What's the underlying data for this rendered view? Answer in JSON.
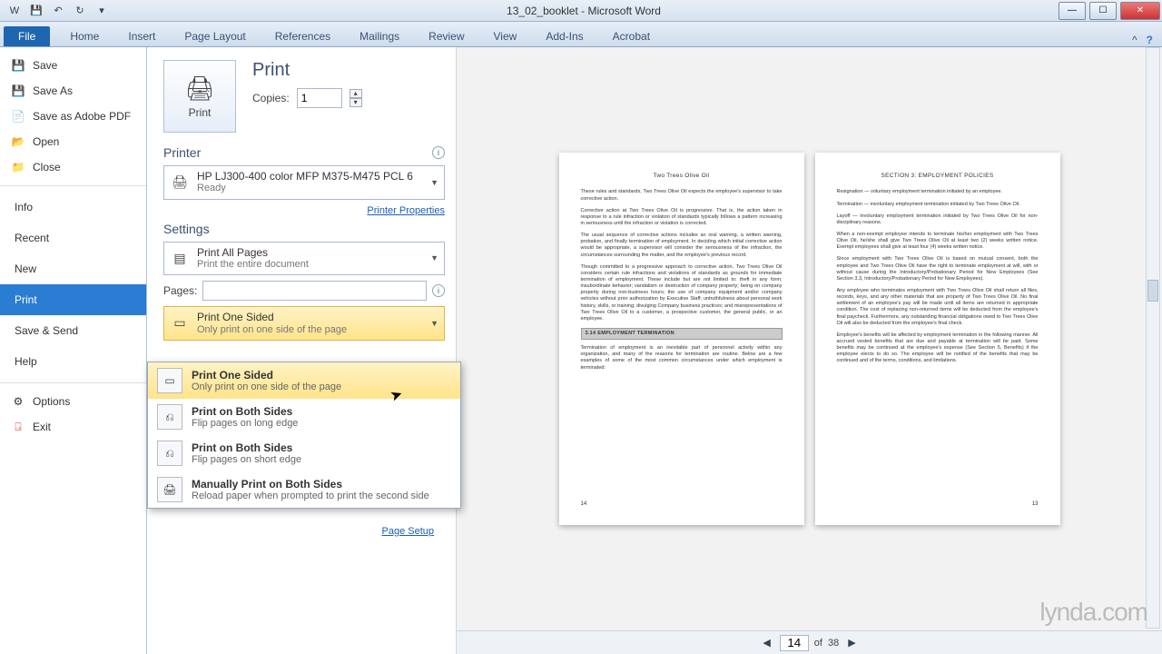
{
  "titlebar": {
    "doc": "13_02_booklet",
    "app": "Microsoft Word"
  },
  "ribbon": {
    "file": "File",
    "tabs": [
      "Home",
      "Insert",
      "Page Layout",
      "References",
      "Mailings",
      "Review",
      "View",
      "Add-Ins",
      "Acrobat"
    ]
  },
  "backstage": {
    "save": "Save",
    "saveas": "Save As",
    "saveadobe": "Save as Adobe PDF",
    "open": "Open",
    "close": "Close",
    "info": "Info",
    "recent": "Recent",
    "new": "New",
    "print": "Print",
    "savesend": "Save & Send",
    "help": "Help",
    "options": "Options",
    "exit": "Exit"
  },
  "print": {
    "heading": "Print",
    "button": "Print",
    "copies_label": "Copies:",
    "copies_value": "1",
    "printer_label": "Printer",
    "printer_name": "HP LJ300-400 color MFP M375-M475 PCL 6",
    "printer_status": "Ready",
    "printer_props": "Printer Properties",
    "settings_label": "Settings",
    "pages_scope_title": "Print All Pages",
    "pages_scope_sub": "Print the entire document",
    "pages_label": "Pages:",
    "duplex_sel_title": "Print One Sided",
    "duplex_sel_sub": "Only print on one side of the page",
    "page_setup": "Page Setup"
  },
  "duplex_options": [
    {
      "t": "Print One Sided",
      "s": "Only print on one side of the page"
    },
    {
      "t": "Print on Both Sides",
      "s": "Flip pages on long edge"
    },
    {
      "t": "Print on Both Sides",
      "s": "Flip pages on short edge"
    },
    {
      "t": "Manually Print on Both Sides",
      "s": "Reload paper when prompted to print the second side"
    }
  ],
  "preview": {
    "page_left_title": "Two Trees Olive Oil",
    "page_left_num": "14",
    "page_left_sect": "3.14 EMPLOYMENT TERMINATION",
    "page_left_paras": [
      "These rules and standards, Two Trees Olive Oil expects the employee's supervisor to take corrective action.",
      "Corrective action at Two Trees Olive Oil is progressive. That is, the action taken in response to a rule infraction or violation of standards typically follows a pattern increasing in seriousness until the infraction or violation is corrected.",
      "The usual sequence of corrective actions includes an oral warning, a written warning, probation, and finally termination of employment. In deciding which initial corrective action would be appropriate, a supervisor will consider the seriousness of the infraction, the circumstances surrounding the matter, and the employee's previous record.",
      "Though committed to a progressive approach to corrective action, Two Trees Olive Oil considers certain rule infractions and violations of standards as grounds for immediate termination of employment. These include but are not limited to: theft in any form; insubordinate behavior; vandalism or destruction of company property; being on company property during non-business hours; the use of company equipment and/or company vehicles without prior authorization by Executive Staff; untruthfulness about personal work history, skills, or training; divulging Company business practices; and misrepresentations of Two Trees Olive Oil to a customer, a prospective customer, the general public, or an employee."
    ],
    "page_left_after": "Termination of employment is an inevitable part of personnel activity within any organization, and many of the reasons for termination are routine. Below are a few examples of some of the most common circumstances under which employment is terminated:",
    "page_right_title": "SECTION 3: EMPLOYMENT POLICIES",
    "page_right_num": "13",
    "page_right_paras": [
      "Resignation — voluntary employment termination initiated by an employee.",
      "Termination — involuntary employment termination initiated by Two Trees Olive Oil.",
      "Layoff — involuntary employment termination initiated by Two Trees Olive Oil for non-disciplinary reasons.",
      "When a non-exempt employee intends to terminate his/her employment with Two Trees Olive Oil, he/she shall give Two Trees Olive Oil at least two (2) weeks written notice. Exempt employees shall give at least four (4) weeks written notice.",
      "Since employment with Two Trees Olive Oil is based on mutual consent, both the employee and Two Trees Olive Oil have the right to terminate employment at will, with or without cause during the Introductory/Probationary Period for New Employees (See Section 3.3, Introductory/Probationary Period for New Employees).",
      "Any employee who terminates employment with Two Trees Olive Oil shall return all files, records, keys, and any other materials that are property of Two Trees Olive Oil. No final settlement of an employee's pay will be made until all items are returned in appropriate condition. The cost of replacing non-returned items will be deducted from the employee's final paycheck. Furthermore, any outstanding financial obligations owed to Two Trees Olive Oil will also be deducted from the employee's final check.",
      "Employee's benefits will be affected by employment termination in the following manner. All accrued vested benefits that are due and payable at termination will be paid. Some benefits may be continued at the employee's expense (See Section 5, Benefits) if the employee elects to do so. The employee will be notified of the benefits that may be continued and of the terms, conditions, and limitations."
    ],
    "nav": {
      "current": "14",
      "of_label": "of",
      "total": "38"
    }
  },
  "watermark": "lynda.com"
}
